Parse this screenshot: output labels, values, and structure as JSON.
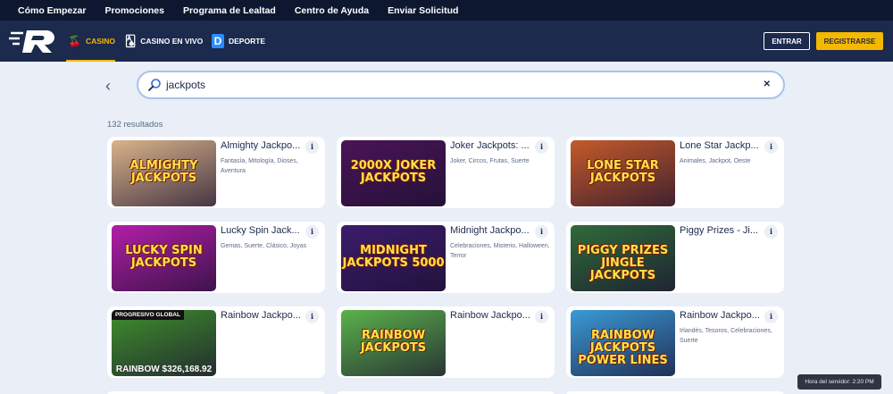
{
  "top_nav": [
    "Cómo Empezar",
    "Promociones",
    "Programa de Lealtad",
    "Centro de Ayuda",
    "Enviar Solicitud"
  ],
  "categories": [
    {
      "label": "CASINO",
      "icon": "cherry-icon",
      "active": true
    },
    {
      "label": "CASINO EN VIVO",
      "icon": "cards-icon",
      "active": false
    },
    {
      "label": "DEPORTE",
      "icon": "deporte-icon",
      "active": false
    }
  ],
  "auth": {
    "login": "ENTRAR",
    "register": "REGISTRARSE"
  },
  "search": {
    "value": "jackpots",
    "clear": "✕"
  },
  "results_count": "132 resultados",
  "games": [
    {
      "title": "Almighty Jackpo...",
      "tags": "Fantasía, Mitología, Dioses, Aventura",
      "thumb_text": "ALMIGHTY JACKPOTS",
      "thumb_color": "#d9b38a"
    },
    {
      "title": "Joker Jackpots: ...",
      "tags": "Joker, Circos, Frutas, Suerte",
      "thumb_text": "2000X JOKER JACKPOTS",
      "thumb_color": "#4a1457"
    },
    {
      "title": "Lone Star Jackp...",
      "tags": "Animales, Jackpot, Oeste",
      "thumb_text": "LONE STAR JACKPOTS",
      "thumb_color": "#c55a2a"
    },
    {
      "title": "Lucky Spin Jack...",
      "tags": "Gemas, Suerte, Clásico, Joyas",
      "thumb_text": "LUCKY SPIN JACKPOTS",
      "thumb_color": "#b21ea8"
    },
    {
      "title": "Midnight Jackpo...",
      "tags": "Celebraciones, Misterio, Halloween, Terror",
      "thumb_text": "MIDNIGHT JACKPOTS 5000",
      "thumb_color": "#3b1c6b"
    },
    {
      "title": "Piggy Prizes - Ji...",
      "tags": "",
      "thumb_text": "PIGGY PRIZES JINGLE JACKPOTS",
      "thumb_color": "#2f6a3a"
    },
    {
      "title": "Rainbow Jackpo...",
      "tags": "",
      "thumb_text": "",
      "thumb_color": "#3f8f2c",
      "badge": "PROGRESIVO GLOBAL",
      "amount": "RAINBOW $326,168.92"
    },
    {
      "title": "Rainbow Jackpo...",
      "tags": "",
      "thumb_text": "RAINBOW JACKPOTS",
      "thumb_color": "#5bb24a"
    },
    {
      "title": "Rainbow Jackpo...",
      "tags": "Irlandés, Tesoros, Celebraciones, Suerte",
      "thumb_text": "RAINBOW JACKPOTS POWER LINES",
      "thumb_color": "#3a9ad6"
    }
  ],
  "info_icon": "i",
  "server_time": "Hora del servidor: 2:20 PM",
  "colors": {
    "accent": "#f5b800",
    "header": "#1b2a4d",
    "topbar": "#0d1830",
    "page": "#e9eef7"
  }
}
